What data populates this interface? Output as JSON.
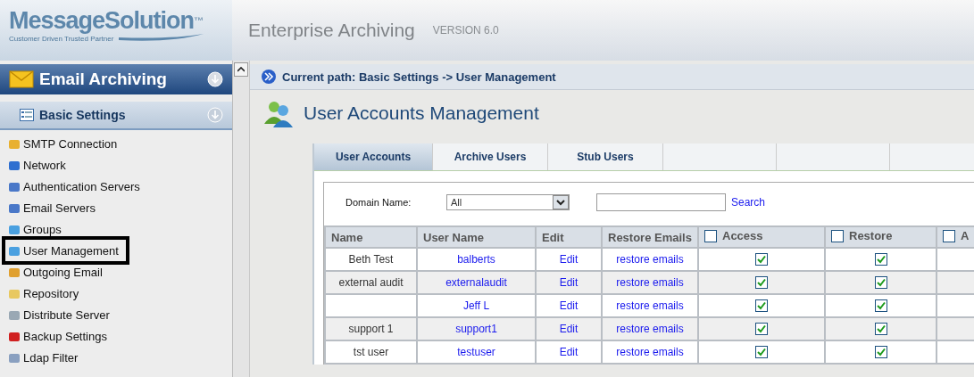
{
  "header": {
    "logo": "MessageSolution",
    "logo_mark": "™",
    "tagline": "Customer Driven Trusted Partner",
    "product": "Enterprise Archiving",
    "version": "VERSION 6.0"
  },
  "sidebar": {
    "section": "Email Archiving",
    "group": "Basic Settings",
    "items": [
      {
        "label": "SMTP Connection",
        "highlighted": false
      },
      {
        "label": "Network",
        "highlighted": false
      },
      {
        "label": "Authentication Servers",
        "highlighted": false
      },
      {
        "label": "Email Servers",
        "highlighted": false
      },
      {
        "label": "Groups",
        "highlighted": false
      },
      {
        "label": "User Management",
        "highlighted": true
      },
      {
        "label": "Outgoing Email",
        "highlighted": false
      },
      {
        "label": "Repository",
        "highlighted": false
      },
      {
        "label": "Distribute Server",
        "highlighted": false
      },
      {
        "label": "Backup Settings",
        "highlighted": false
      },
      {
        "label": "Ldap Filter",
        "highlighted": false
      }
    ]
  },
  "breadcrumb": "Current path: Basic Settings -> User Management",
  "page_title": "User Accounts Management",
  "tabs": [
    {
      "label": "User Accounts",
      "selected": true
    },
    {
      "label": "Archive Users",
      "selected": false
    },
    {
      "label": "Stub Users",
      "selected": false
    }
  ],
  "filter": {
    "label": "Domain Name:",
    "domain": "All",
    "search_button": "Search"
  },
  "table": {
    "columns": [
      {
        "label": "Name",
        "kind": "text"
      },
      {
        "label": "User Name",
        "kind": "text"
      },
      {
        "label": "Edit",
        "kind": "text"
      },
      {
        "label": "Restore Emails",
        "kind": "text"
      },
      {
        "label": "Access",
        "kind": "checkbox",
        "checked": false
      },
      {
        "label": "Restore",
        "kind": "checkbox",
        "checked": false
      },
      {
        "label": "A",
        "kind": "checkbox",
        "checked": false
      }
    ],
    "rows": [
      {
        "name": "Beth Test",
        "user_name": "balberts",
        "edit": "Edit",
        "restore": "restore emails",
        "access": true,
        "restore_allowed": true
      },
      {
        "name": "external audit",
        "user_name": "externalaudit",
        "edit": "Edit",
        "restore": "restore emails",
        "access": true,
        "restore_allowed": true
      },
      {
        "name": "",
        "user_name": "Jeff L",
        "edit": "Edit",
        "restore": "restore emails",
        "access": true,
        "restore_allowed": true
      },
      {
        "name": "support 1",
        "user_name": "support1",
        "edit": "Edit",
        "restore": "restore emails",
        "access": true,
        "restore_allowed": true
      },
      {
        "name": "tst user",
        "user_name": "testuser",
        "edit": "Edit",
        "restore": "restore emails",
        "access": true,
        "restore_allowed": true
      }
    ]
  }
}
